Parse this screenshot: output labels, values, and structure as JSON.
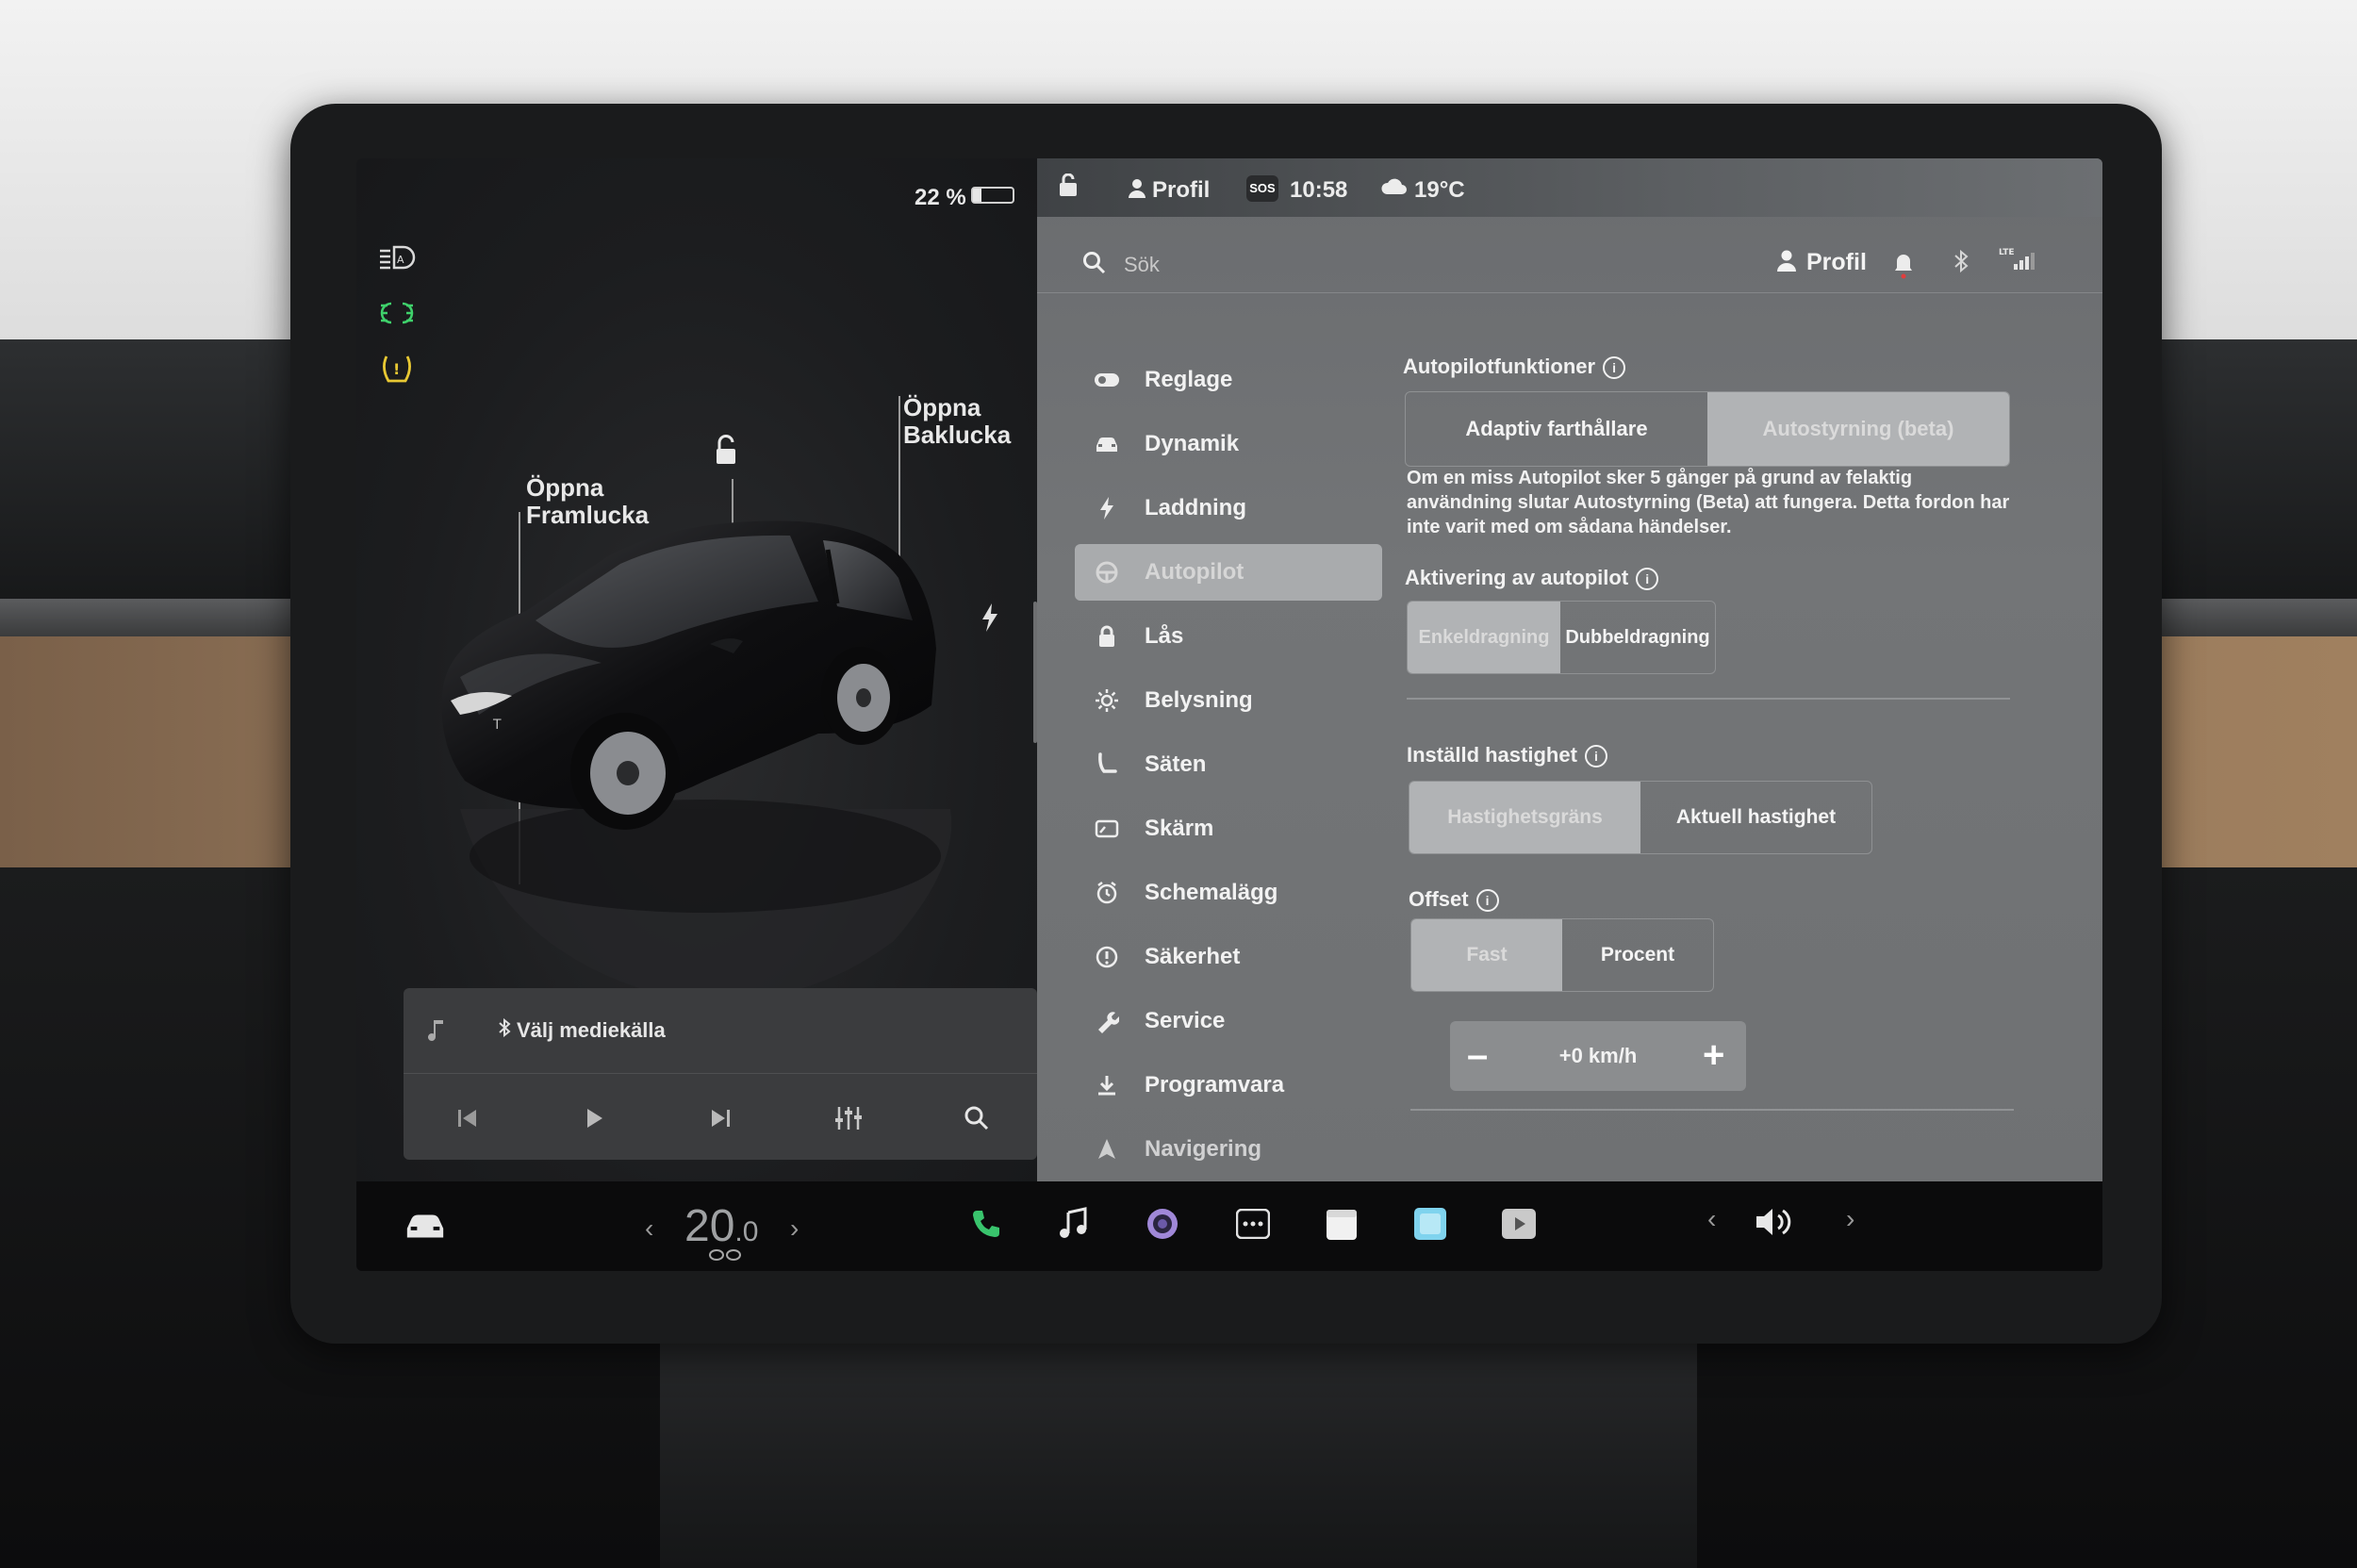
{
  "status": {
    "battery_percent_label": "22 %",
    "battery_level": 0.22
  },
  "car": {
    "frunk_label": [
      "Öppna",
      "Framlucka"
    ],
    "trunk_label": [
      "Öppna",
      "Baklucka"
    ]
  },
  "media": {
    "source_label": "Välj mediekälla"
  },
  "topbar": {
    "profile": "Profil",
    "sos": "SOS",
    "time": "10:58",
    "temperature": "19°C"
  },
  "search": {
    "placeholder": "Sök",
    "profile": "Profil"
  },
  "menu": {
    "items": [
      {
        "label": "Reglage",
        "icon": "toggle-icon"
      },
      {
        "label": "Dynamik",
        "icon": "car-icon"
      },
      {
        "label": "Laddning",
        "icon": "bolt-icon"
      },
      {
        "label": "Autopilot",
        "icon": "steering-wheel-icon",
        "active": true
      },
      {
        "label": "Lås",
        "icon": "lock-icon"
      },
      {
        "label": "Belysning",
        "icon": "light-icon"
      },
      {
        "label": "Säten",
        "icon": "seat-icon"
      },
      {
        "label": "Skärm",
        "icon": "display-icon"
      },
      {
        "label": "Schemalägg",
        "icon": "clock-icon"
      },
      {
        "label": "Säkerhet",
        "icon": "alert-icon"
      },
      {
        "label": "Service",
        "icon": "wrench-icon"
      },
      {
        "label": "Programvara",
        "icon": "download-icon"
      },
      {
        "label": "Navigering",
        "icon": "navigation-icon"
      }
    ]
  },
  "autopilot": {
    "features_title": "Autopilotfunktioner",
    "features_options": [
      "Adaptiv farthållare",
      "Autostyrning (beta)"
    ],
    "features_selected": 1,
    "description": "Om en miss Autopilot sker 5 gånger på grund av felaktig användning slutar Autostyrning (Beta) att fungera. Detta fordon har inte varit med om sådana händelser.",
    "activation_title": "Aktivering av autopilot",
    "activation_options": [
      "Enkeldragning",
      "Dubbeldragning"
    ],
    "activation_selected": 0,
    "speed_title": "Inställd hastighet",
    "speed_options": [
      "Hastighetsgräns",
      "Aktuell hastighet"
    ],
    "speed_selected": 0,
    "offset_title": "Offset",
    "offset_options": [
      "Fast",
      "Procent"
    ],
    "offset_selected": 0,
    "offset_value": "+0 km/h",
    "minus": "–",
    "plus": "+"
  },
  "taskbar": {
    "temp_whole": "20",
    "temp_decimal": ".0"
  },
  "colors": {
    "active_segment": "#b1b3b5",
    "settings_bg": "#707274",
    "headlight_green": "#3fd16b",
    "warning_yellow": "#e8c833"
  }
}
